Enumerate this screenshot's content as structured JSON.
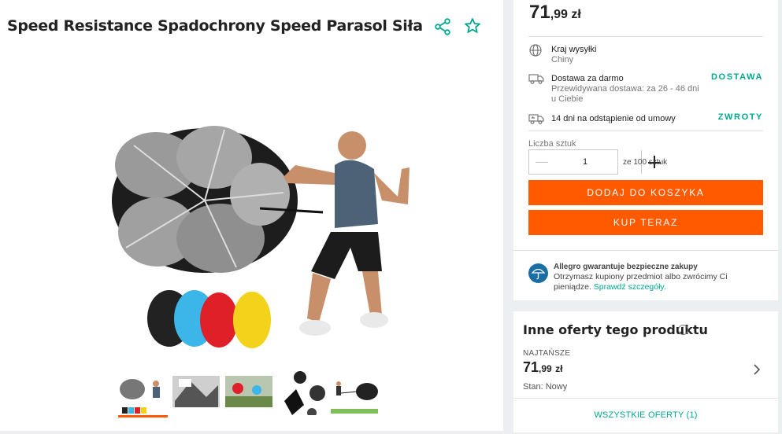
{
  "product": {
    "title": "Speed Resistance Spadochrony Speed Parasol Siła",
    "icons": {
      "share": "share-icon",
      "favorite": "star-outline-icon"
    },
    "accent_color": "#00a790",
    "thumbnails_count": 5
  },
  "purchase": {
    "price": {
      "int": "71",
      "frac": ",99",
      "currency": "zł"
    },
    "shipping_country_label": "Kraj wysyłki",
    "shipping_country_value": "Chiny",
    "free_delivery_label": "Dostawa za darmo",
    "expected_delivery": "Przewidywana dostawa: za 26 - 46 dni u Ciebie",
    "delivery_link": "DOSTAWA",
    "returns_label": "14 dni na odstąpienie od umowy",
    "returns_link": "ZWROTY",
    "quantity_label": "Liczba sztuk",
    "quantity_value": "1",
    "quantity_of": "ze 100 sztuk",
    "add_to_cart": "DODAJ DO KOSZYKA",
    "buy_now": "KUP TERAZ",
    "button_color": "#ff5a00",
    "guarantee_title": "Allegro gwarantuje bezpieczne zakupy",
    "guarantee_text": "Otrzymasz kupiony przedmiot albo zwrócimy Ci pieniądze.",
    "guarantee_link": "Sprawdź szczegóły."
  },
  "offers": {
    "title": "Inne oferty tego produktu",
    "cheapest_label": "NAJTAŃSZE",
    "price": {
      "int": "71",
      "frac": ",99",
      "currency": "zł"
    },
    "state": "Stan: Nowy",
    "all_offers": "WSZYSTKIE OFERTY (1)"
  }
}
